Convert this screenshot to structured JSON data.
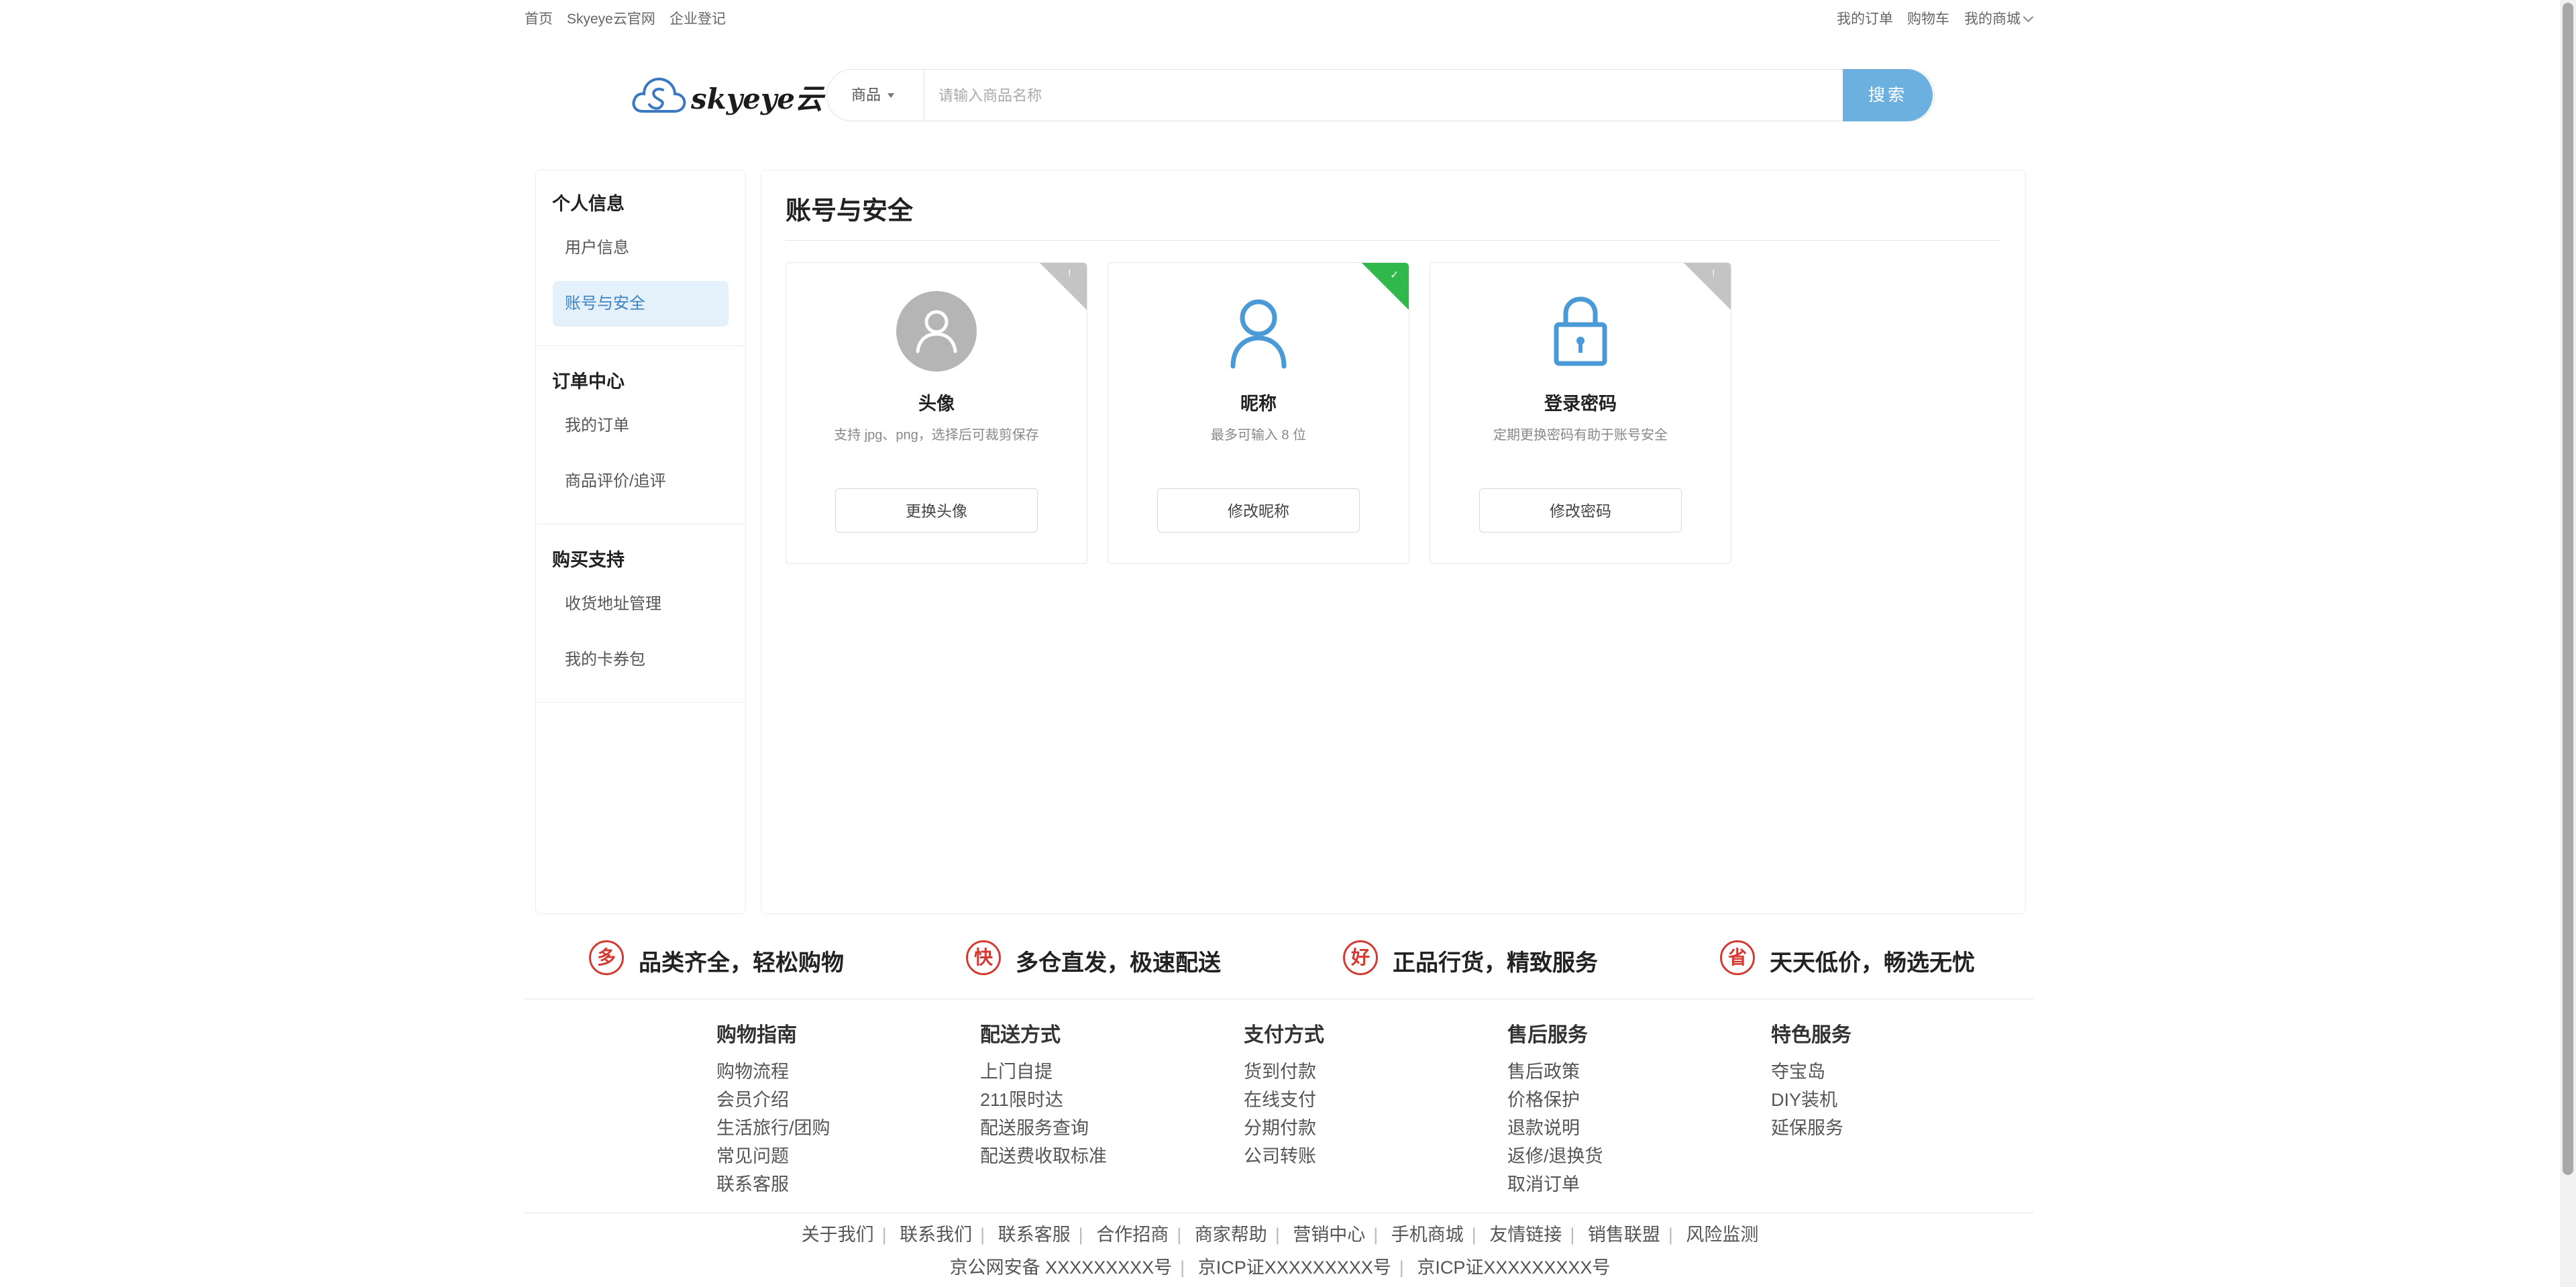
{
  "top_nav": {
    "left": [
      "首页",
      "Skyeye云官网",
      "企业登记"
    ],
    "right": [
      "我的订单",
      "购物车",
      "我的商城"
    ]
  },
  "logo": {
    "text": "skyeye云"
  },
  "search": {
    "category": "商品",
    "placeholder": "请输入商品名称",
    "button": "搜索"
  },
  "sidebar": {
    "groups": [
      {
        "title": "个人信息",
        "items": [
          "用户信息",
          "账号与安全"
        ]
      },
      {
        "title": "订单中心",
        "items": [
          "我的订单",
          "商品评价/追评"
        ]
      },
      {
        "title": "购买支持",
        "items": [
          "收货地址管理",
          "我的卡券包"
        ]
      }
    ],
    "active_item": "账号与安全"
  },
  "main": {
    "title": "账号与安全",
    "cards": [
      {
        "title": "头像",
        "desc": "支持 jpg、png，选择后可裁剪保存",
        "button": "更换头像",
        "icon": "avatar-placeholder-icon",
        "status_corner": "grey",
        "status_mark": "!"
      },
      {
        "title": "昵称",
        "desc": "最多可输入 8 位",
        "button": "修改昵称",
        "icon": "user-icon",
        "status_corner": "green",
        "status_mark": "✓"
      },
      {
        "title": "登录密码",
        "desc": "定期更换密码有助于账号安全",
        "button": "修改密码",
        "icon": "lock-icon",
        "status_corner": "grey",
        "status_mark": "!"
      }
    ]
  },
  "features": [
    {
      "badge": "多",
      "text": "品类齐全，轻松购物"
    },
    {
      "badge": "快",
      "text": "多仓直发，极速配送"
    },
    {
      "badge": "好",
      "text": "正品行货，精致服务"
    },
    {
      "badge": "省",
      "text": "天天低价，畅选无忧"
    }
  ],
  "footer": {
    "columns": [
      {
        "title": "购物指南",
        "links": [
          "购物流程",
          "会员介绍",
          "生活旅行/团购",
          "常见问题",
          "联系客服"
        ]
      },
      {
        "title": "配送方式",
        "links": [
          "上门自提",
          "211限时达",
          "配送服务查询",
          "配送费收取标准"
        ]
      },
      {
        "title": "支付方式",
        "links": [
          "货到付款",
          "在线支付",
          "分期付款",
          "公司转账"
        ]
      },
      {
        "title": "售后服务",
        "links": [
          "售后政策",
          "价格保护",
          "退款说明",
          "返修/退换货",
          "取消订单"
        ]
      },
      {
        "title": "特色服务",
        "links": [
          "夺宝岛",
          "DIY装机",
          "延保服务"
        ]
      }
    ],
    "bottom_links": [
      "关于我们",
      "联系我们",
      "联系客服",
      "合作招商",
      "商家帮助",
      "营销中心",
      "手机商城",
      "友情链接",
      "销售联盟",
      "风险监测"
    ],
    "licenses": [
      "京公网安备 XXXXXXXXX号",
      "京ICP证XXXXXXXXX号",
      "京ICP证XXXXXXXXX号"
    ]
  },
  "colors": {
    "accent": "#6cb0e0",
    "active_bg": "#e4f1fb",
    "active_text": "#3b83c3",
    "badge_red": "#d33b32",
    "ok_green": "#30b94a"
  }
}
